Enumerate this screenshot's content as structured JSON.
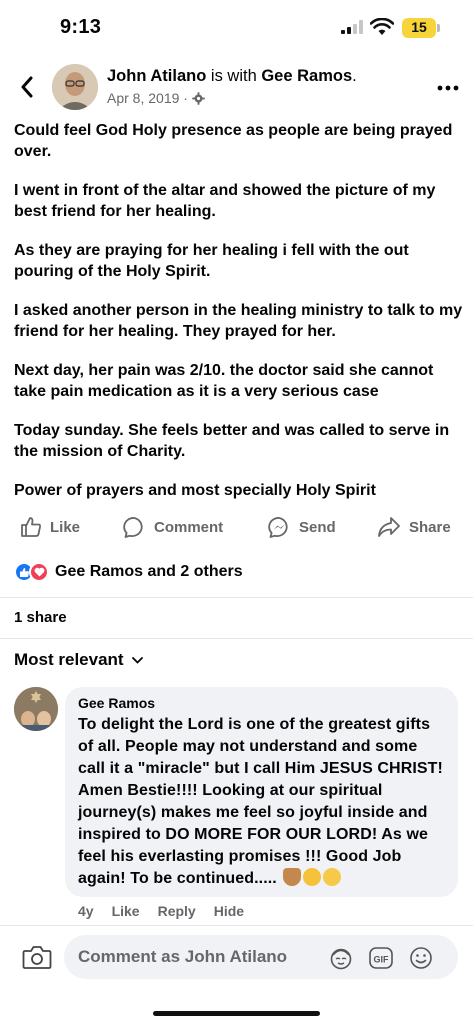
{
  "status_bar": {
    "time": "9:13",
    "battery": "15"
  },
  "post": {
    "author": "John Atilano",
    "with_text": "is with",
    "tagged": "Gee Ramos",
    "date": "Apr 8, 2019 ·",
    "paragraphs": [
      "Could feel God Holy presence as people are being prayed over.",
      "I went in front of the altar and showed the picture of my best friend for her healing.",
      "As they are praying for her healing i fell with the out pouring of the Holy Spirit.",
      "I asked another person in the healing ministry to talk to my friend for her healing. They prayed for her.",
      "Next day, her pain was 2/10.  the doctor  said she cannot take pain medication as it is a very serious case",
      "Today sunday. She feels better and was called to serve in the mission of Charity.",
      "Power of prayers and most specially Holy Spirit"
    ]
  },
  "actions": {
    "like": "Like",
    "comment": "Comment",
    "send": "Send",
    "share": "Share"
  },
  "reactions_text": "Gee Ramos and 2 others",
  "shares_text": "1 share",
  "sort_label": "Most relevant",
  "comment": {
    "name": "Gee Ramos",
    "text": "To delight the Lord is one of the greatest gifts of all. People may not understand and some call it a \"miracle\" but I call Him JESUS CHRIST! Amen Bestie!!!! Looking at our spiritual journey(s) makes me feel so joyful inside and inspired to DO MORE FOR OUR LORD! As we feel his everlasting promises !!! Good Job again! To be continued.....",
    "age": "4y",
    "like": "Like",
    "reply": "Reply",
    "hide": "Hide"
  },
  "composer": {
    "placeholder": "Comment as John Atilano",
    "gif_label": "GIF"
  },
  "colors": {
    "accent": "#1877f2",
    "love": "#f33e58",
    "secondary_text": "#65676b",
    "bubble": "#f0f2f5",
    "battery": "#f7d53a"
  }
}
